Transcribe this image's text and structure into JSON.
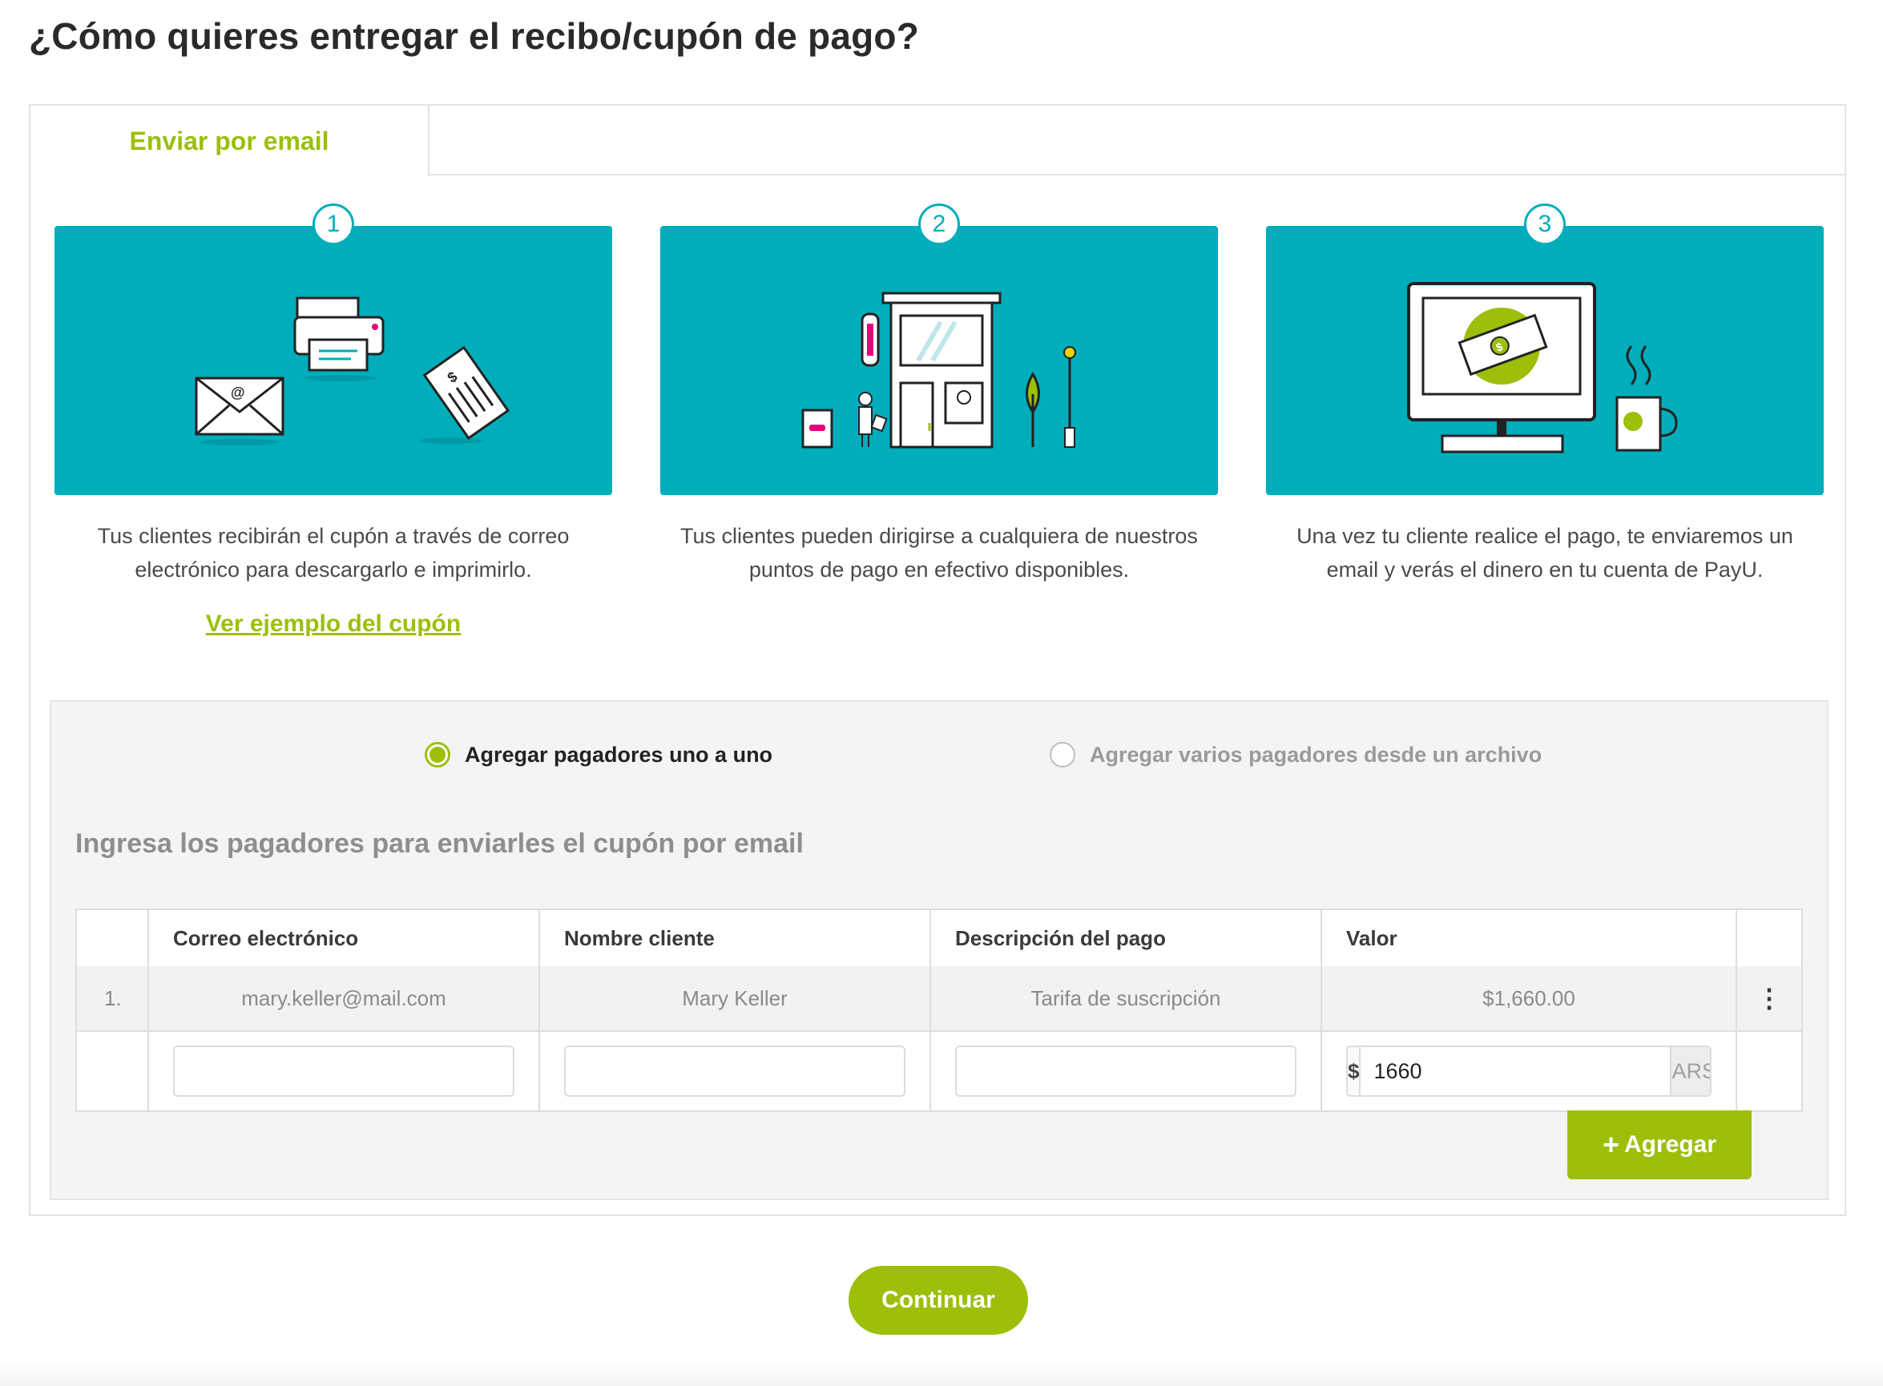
{
  "page": {
    "title": "¿Cómo quieres entregar el recibo/cupón de pago?"
  },
  "tabs": [
    {
      "label": "Enviar por email",
      "active": true
    }
  ],
  "steps": [
    {
      "number": "1",
      "text": "Tus clientes recibirán el cupón a través de correo electrónico para descargarlo e imprimirlo.",
      "link": "Ver ejemplo del cupón",
      "illustration": "email-printer-receipt-icon"
    },
    {
      "number": "2",
      "text": "Tus clientes pueden dirigirse a cualquiera de nuestros puntos de pago en efectivo disponibles.",
      "illustration": "store-payment-point-icon"
    },
    {
      "number": "3",
      "text": "Una vez tu cliente realice el pago, te enviaremos un email y verás el dinero en tu cuenta de PayU.",
      "illustration": "monitor-money-coffee-icon"
    }
  ],
  "form": {
    "options": [
      {
        "label": "Agregar pagadores uno a uno",
        "selected": true
      },
      {
        "label": "Agregar varios pagadores desde un archivo",
        "selected": false
      }
    ],
    "heading": "Ingresa los pagadores para enviarles el cupón por email",
    "columns": [
      "Correo electrónico",
      "Nombre cliente",
      "Descripción del pago",
      "Valor"
    ],
    "rows": [
      {
        "index": "1.",
        "email": "mary.keller@mail.com",
        "name": "Mary Keller",
        "description": "Tarifa de suscripción",
        "value": "$1,660.00"
      }
    ],
    "new_row": {
      "email": "",
      "name": "",
      "description": "",
      "currency_symbol": "$",
      "amount": "1660",
      "currency": "ARS"
    },
    "add_button": "Agregar"
  },
  "continue_button": "Continuar",
  "colors": {
    "accent": "#9cbf0a",
    "teal": "#00adbb"
  }
}
